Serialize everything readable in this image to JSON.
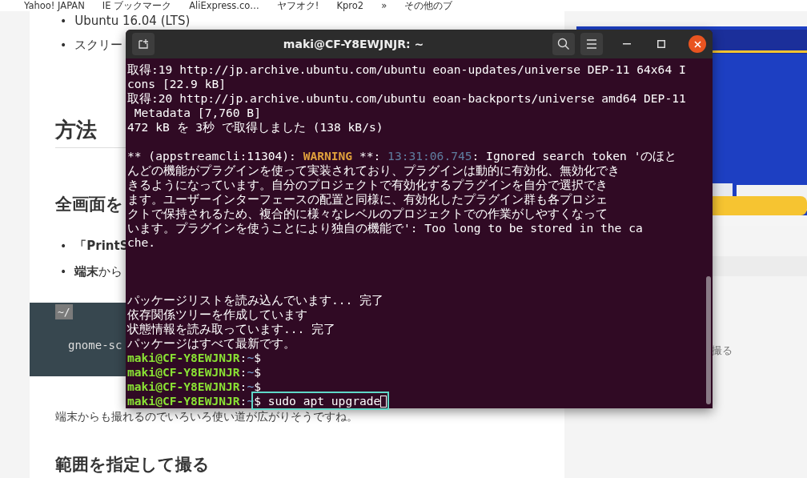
{
  "bookmarks": [
    "Yahoo! JAPAN",
    "IE ブックマーク",
    "AliExpress.co…",
    "ヤフオク!",
    "Kpro2",
    "»",
    "その他のブ"
  ],
  "article": {
    "top_bullets": [
      {
        "marker": "•",
        "text": "Ubuntu 16.04 (LTS)"
      },
      {
        "marker": "•",
        "text": "スクリー"
      }
    ],
    "heading": "方法",
    "subheading": "全画面を",
    "bullets": [
      {
        "marker": "•",
        "text": "**「PrintS**"
      },
      {
        "marker": "•",
        "text": "**端末**から"
      }
    ],
    "code": {
      "label": "~/",
      "line": "gnome-sc"
    },
    "paragraph": "端末からも撮れるのでいろいろ使い道が広がりそうですね。",
    "next_heading": "範囲を指定して撮る"
  },
  "sidebar": {
    "toc_text": "撮る"
  },
  "terminal": {
    "title": "maki@CF-Y8EWJNJR: ~",
    "lines": [
      {
        "kind": "text",
        "segments": [
          {
            "kind": "plain",
            "text": "取得:19 http://jp.archive.ubuntu.com/ubuntu eoan-updates/universe DEP-11 64x64 I"
          }
        ]
      },
      {
        "kind": "text",
        "segments": [
          {
            "kind": "plain",
            "text": "cons [22.9 kB]"
          }
        ]
      },
      {
        "kind": "text",
        "segments": [
          {
            "kind": "plain",
            "text": "取得:20 http://jp.archive.ubuntu.com/ubuntu eoan-backports/universe amd64 DEP-11"
          }
        ]
      },
      {
        "kind": "text",
        "segments": [
          {
            "kind": "plain",
            "text": " Metadata [7,760 B]"
          }
        ]
      },
      {
        "kind": "text",
        "segments": [
          {
            "kind": "plain",
            "text": "472 kB を 3秒 で取得しました (138 kB/s)"
          }
        ]
      },
      {
        "kind": "blank"
      },
      {
        "kind": "text",
        "segments": [
          {
            "kind": "plain",
            "text": "** (appstreamcli:11304): "
          },
          {
            "kind": "warning",
            "text": "WARNING"
          },
          {
            "kind": "plain",
            "text": " **: "
          },
          {
            "kind": "time",
            "text": "13:31:06.745"
          },
          {
            "kind": "plain",
            "text": ": Ignored search token 'のほと"
          }
        ]
      },
      {
        "kind": "text",
        "segments": [
          {
            "kind": "plain",
            "text": "んどの機能がプラグインを使って実装されており、プラグインは動的に有効化、無効化でき"
          }
        ]
      },
      {
        "kind": "text",
        "segments": [
          {
            "kind": "plain",
            "text": "きるようになっています。自分のプロジェクトで有効化するプラグインを自分で選択でき"
          }
        ]
      },
      {
        "kind": "text",
        "segments": [
          {
            "kind": "plain",
            "text": "ます。ユーザーインターフェースの配置と同様に、有効化したプラグイン群も各プロジェ"
          }
        ]
      },
      {
        "kind": "text",
        "segments": [
          {
            "kind": "plain",
            "text": "クトで保持されるため、複合的に様々なレベルのプロジェクトでの作業がしやすくなって"
          }
        ]
      },
      {
        "kind": "text",
        "segments": [
          {
            "kind": "plain",
            "text": "います。プラグインを使うことにより独自の機能で': Too long to be stored in the ca"
          }
        ]
      },
      {
        "kind": "text",
        "segments": [
          {
            "kind": "plain",
            "text": "che."
          }
        ]
      },
      {
        "kind": "blank"
      },
      {
        "kind": "blank"
      },
      {
        "kind": "blank"
      },
      {
        "kind": "text",
        "segments": [
          {
            "kind": "plain",
            "text": "パッケージリストを読み込んでいます... 完了"
          }
        ]
      },
      {
        "kind": "text",
        "segments": [
          {
            "kind": "plain",
            "text": "依存関係ツリーを作成しています"
          }
        ]
      },
      {
        "kind": "text",
        "segments": [
          {
            "kind": "plain",
            "text": "状態情報を読み取っています... 完了"
          }
        ]
      },
      {
        "kind": "text",
        "segments": [
          {
            "kind": "plain",
            "text": "パッケージはすべて最新です。"
          }
        ]
      },
      {
        "kind": "text",
        "segments": [
          {
            "kind": "user",
            "text": "maki@CF-Y8EWJNJR"
          },
          {
            "kind": "plain",
            "text": ":"
          },
          {
            "kind": "path",
            "text": "~"
          },
          {
            "kind": "plain",
            "text": "$"
          }
        ]
      },
      {
        "kind": "text",
        "segments": [
          {
            "kind": "user",
            "text": "maki@CF-Y8EWJNJR"
          },
          {
            "kind": "plain",
            "text": ":"
          },
          {
            "kind": "path",
            "text": "~"
          },
          {
            "kind": "plain",
            "text": "$"
          }
        ]
      },
      {
        "kind": "text",
        "segments": [
          {
            "kind": "user",
            "text": "maki@CF-Y8EWJNJR"
          },
          {
            "kind": "plain",
            "text": ":"
          },
          {
            "kind": "path",
            "text": "~"
          },
          {
            "kind": "plain",
            "text": "$"
          }
        ]
      },
      {
        "kind": "text",
        "segments": [
          {
            "kind": "user",
            "text": "maki@CF-Y8EWJNJR"
          },
          {
            "kind": "plain",
            "text": ":"
          },
          {
            "kind": "path",
            "text": "~"
          },
          {
            "kind": "command",
            "text": "$ sudo apt upgrade"
          }
        ]
      }
    ]
  }
}
